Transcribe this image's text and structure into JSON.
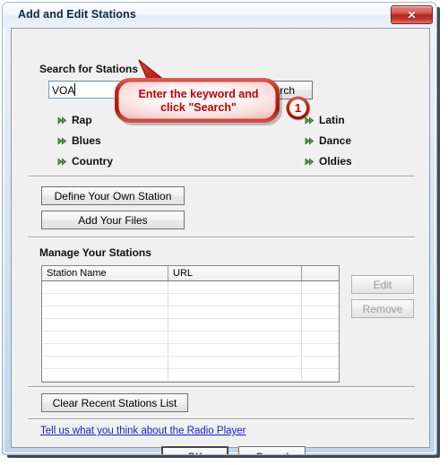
{
  "window": {
    "title": "Add and Edit Stations",
    "close_label": "✕"
  },
  "search_section": {
    "title": "Search for Stations",
    "input_value": "VOA",
    "input_placeholder": "",
    "search_button": "Search"
  },
  "genres": {
    "left": [
      "Rap",
      "Blues",
      "Country"
    ],
    "right": [
      "Latin",
      "Dance",
      "Oldies"
    ]
  },
  "actions": {
    "define_station": "Define Your Own Station",
    "add_files": "Add Your Files"
  },
  "manage_section": {
    "title": "Manage Your Stations",
    "columns": [
      "Station Name",
      "URL",
      ""
    ],
    "rows": [
      [
        "",
        "",
        ""
      ],
      [
        "",
        "",
        ""
      ],
      [
        "",
        "",
        ""
      ],
      [
        "",
        "",
        ""
      ],
      [
        "",
        "",
        ""
      ],
      [
        "",
        "",
        ""
      ],
      [
        "",
        "",
        ""
      ],
      [
        "",
        "",
        ""
      ]
    ],
    "edit_button": "Edit",
    "remove_button": "Remove",
    "clear_button": "Clear Recent Stations List"
  },
  "footer": {
    "feedback_link": "Tell us what you think about the Radio Player",
    "ok_button": "OK",
    "cancel_button": "Cancel"
  },
  "annotations": {
    "callout_line1": "Enter the keyword and",
    "callout_line2": "click \"Search\"",
    "badge_number": "1"
  },
  "colors": {
    "annotation_red": "#c00000",
    "link_blue": "#1a1ad6",
    "genre_green": "#3f9a3f",
    "dialog_face": "#f0f0f0"
  }
}
